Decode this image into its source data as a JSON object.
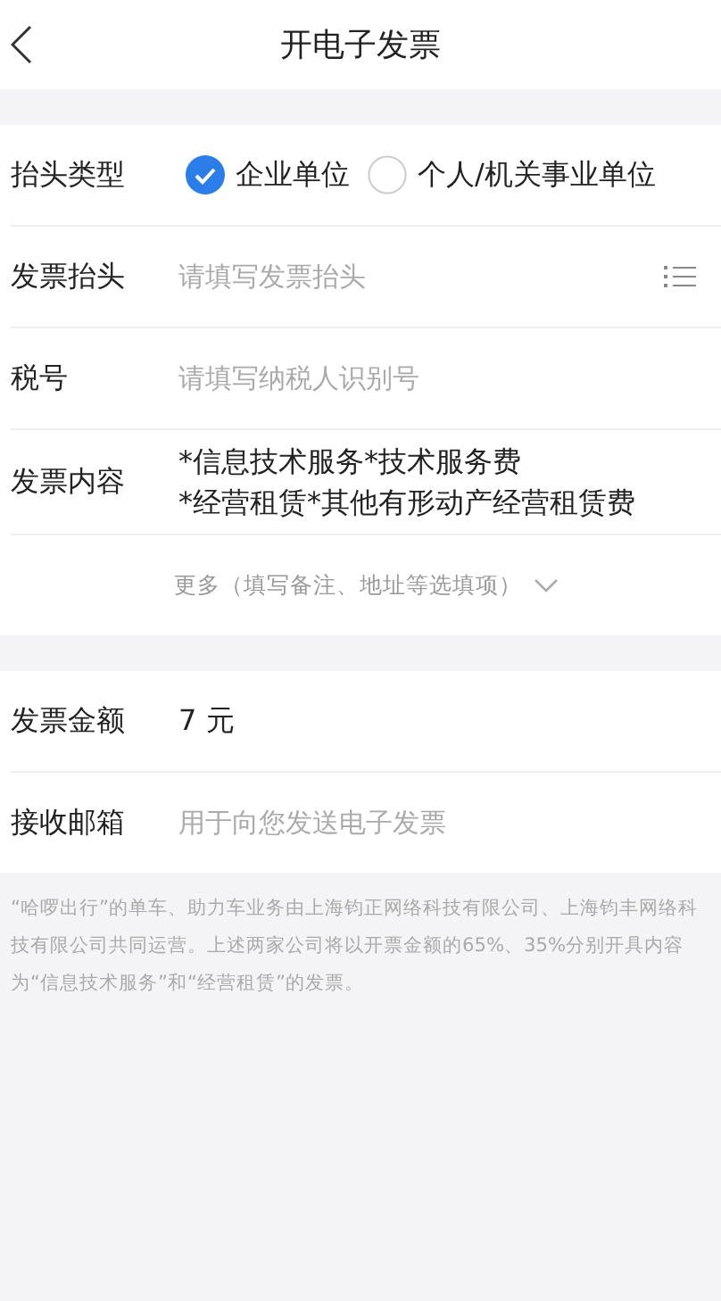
{
  "header": {
    "title": "开电子发票"
  },
  "title_type": {
    "label": "抬头类型",
    "options": [
      {
        "label": "企业单位",
        "selected": true
      },
      {
        "label": "个人/机关事业单位",
        "selected": false
      }
    ]
  },
  "fields": [
    {
      "label": "发票抬头",
      "placeholder": "请填写发票抬头",
      "kind": "list"
    },
    {
      "label": "税号",
      "placeholder": "请填写纳税人识别号",
      "kind": "plain"
    }
  ],
  "content": {
    "label": "发票内容",
    "lines": [
      "*信息技术服务*技术服务费",
      "*经营租赁*其他有形动产经营租赁费"
    ]
  },
  "more": {
    "label": "更多（填写备注、地址等选填项）"
  },
  "amount": {
    "label": "发票金额",
    "value": "7 元"
  },
  "email": {
    "label": "接收邮箱",
    "placeholder": "用于向您发送电子发票"
  },
  "note": "“哈啰出行”的单车、助力车业务由上海钧正网络科技有限公司、上海钧丰网络科技有限公司共同运营。上述两家公司将以开票金额的65%、35%分别开具内容为“信息技术服务”和“经营租赁”的发票。"
}
